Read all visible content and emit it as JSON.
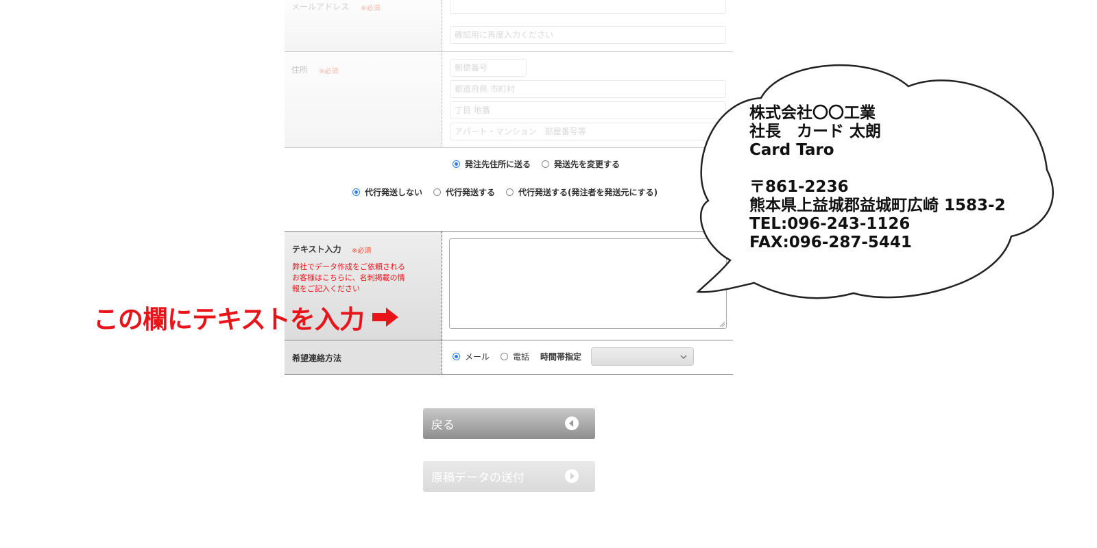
{
  "form": {
    "email": {
      "label": "メールアドレス",
      "required": "※必須",
      "confirm_placeholder": "確認用に再度入力ください"
    },
    "address": {
      "label": "住所",
      "required": "※必須",
      "postal_placeholder": "郵便番号",
      "city_placeholder": "都道府県 市町村",
      "block_placeholder": "丁目 地番",
      "building_placeholder": "アパート・マンション　部屋番号等"
    },
    "shipping_dest": {
      "options": [
        "発注先住所に送る",
        "発送先を変更する"
      ],
      "selected": 0
    },
    "proxy_shipping": {
      "options": [
        "代行発送しない",
        "代行発送する",
        "代行発送する(発注者を発送元にする)"
      ],
      "selected": 0
    },
    "text_input": {
      "label": "テキスト入力",
      "required": "※必須",
      "note": [
        "弊社でデータ作成をご依頼される",
        "お客様はこちらに、名刺掲載の情",
        "報をご記入ください"
      ]
    },
    "contact": {
      "label": "希望連絡方法",
      "options": [
        "メール",
        "電話"
      ],
      "selected": 0,
      "time_label": "時間帯指定"
    }
  },
  "annotation": {
    "callout": "この欄にテキストを入力",
    "color": "#e8141a"
  },
  "speech_bubble": {
    "lines": [
      "株式会社〇〇工業",
      "社長　カード 太朗",
      "Card Taro",
      "",
      "〒861-2236",
      "熊本県上益城郡益城町広崎 1583-2",
      "TEL:096-243-1126",
      "FAX:096-287-5441"
    ]
  },
  "buttons": {
    "back": "戻る",
    "send": "原稿データの送付"
  }
}
